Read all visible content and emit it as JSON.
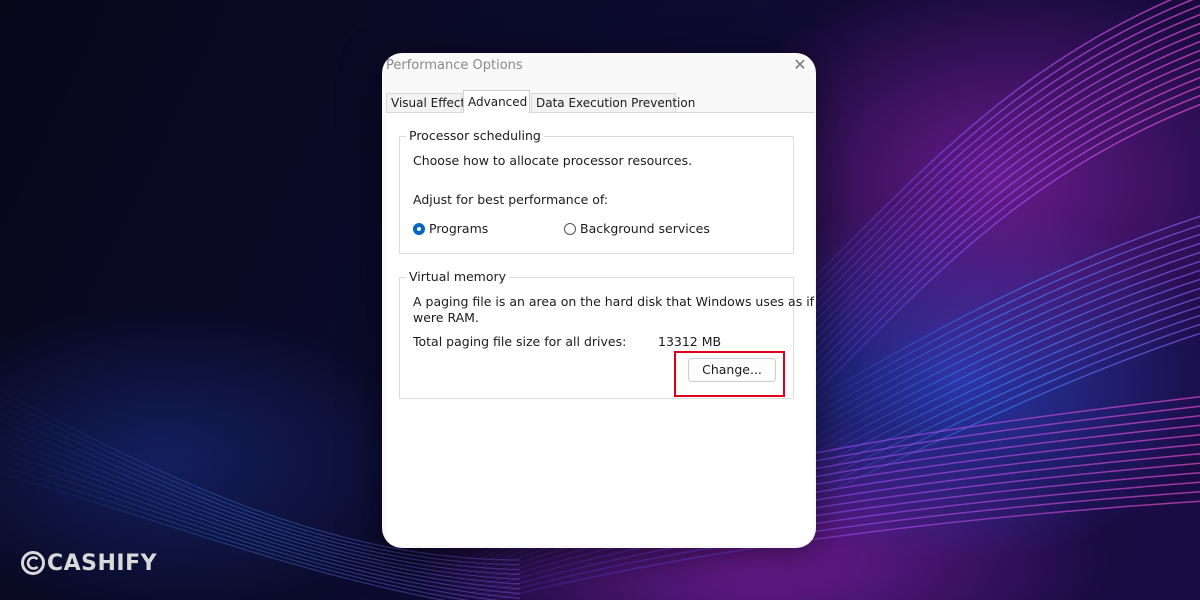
{
  "dialog": {
    "title": "Performance Options",
    "close_icon": "close-icon",
    "tabs": [
      {
        "label": "Visual Effects",
        "active": false
      },
      {
        "label": "Advanced",
        "active": true
      },
      {
        "label": "Data Execution Prevention",
        "active": false
      }
    ]
  },
  "processor_scheduling": {
    "group_label": "Processor scheduling",
    "description": "Choose how to allocate processor resources.",
    "adjust_label": "Adjust for best performance of:",
    "options": [
      {
        "label": "Programs",
        "selected": true
      },
      {
        "label": "Background services",
        "selected": false
      }
    ]
  },
  "virtual_memory": {
    "group_label": "Virtual memory",
    "description_line1": "A paging file is an area on the hard disk that Windows uses as if it",
    "description_line2": "were RAM.",
    "total_label": "Total paging file size for all drives:",
    "total_value": "13312 MB",
    "change_button": "Change..."
  },
  "annotation": {
    "highlight_color": "#e0001a"
  },
  "watermark": {
    "text": "CASHIFY"
  },
  "colors": {
    "accent": "#0067c0"
  }
}
